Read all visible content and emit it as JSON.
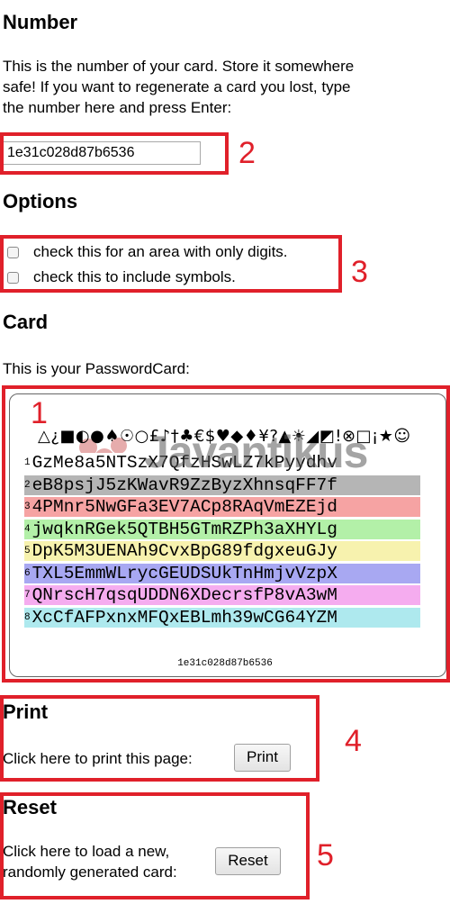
{
  "number_section": {
    "title": "Number",
    "desc_line1": "This is the number of your card. Store it somewhere",
    "desc_line2": "safe! If you want to regenerate a card you lost, type",
    "desc_line3": "the number here and press Enter:",
    "card_number_value": "1e31c028d87b6536"
  },
  "options_section": {
    "title": "Options",
    "digits_label": "check this for an area with only digits.",
    "digits_checked": false,
    "symbols_label": "check this to include symbols.",
    "symbols_checked": false
  },
  "card_section": {
    "title": "Card",
    "desc": "This is your PasswordCard:",
    "header_symbols": "△¿■◐●♠☉○£♪†♣€$♥◆♦¥?▲☀◢◩!⊗□¡★☺",
    "rows": [
      {
        "n": "1",
        "text": "GzMe8a5NTSzX7QfzHSwLZ7kPyydhv",
        "color": "#ffffff"
      },
      {
        "n": "2",
        "text": "eB8psjJ5zKWavR9ZzByzXhnsqFF7f",
        "color": "#b5b5b5"
      },
      {
        "n": "3",
        "text": "4PMnr5NwGFa3EV7ACp8RAqVmEZEjd",
        "color": "#f6a3a3"
      },
      {
        "n": "4",
        "text": "jwqknRGek5QTBH5GTmRZPh3aXHYLg",
        "color": "#b3f0a8"
      },
      {
        "n": "5",
        "text": "DpK5M3UENAh9CvxBpG89fdgxeuGJy",
        "color": "#f7f2ae"
      },
      {
        "n": "6",
        "text": "TXL5EmmWLrycGEUDSUkTnHmjvVzpX",
        "color": "#a8a8f2"
      },
      {
        "n": "7",
        "text": "QNrscH7qsqUDDN6XDecrsfP8vA3wM",
        "color": "#f5acef"
      },
      {
        "n": "8",
        "text": "XcCfAFPxnxMFQxEBLmh39wCG64YZM",
        "color": "#aee9ee"
      }
    ],
    "card_number_footer": "1e31c028d87b6536",
    "watermark": "Javantikus"
  },
  "print_section": {
    "title": "Print",
    "desc": "Click here to print this page:",
    "button_label": "Print"
  },
  "reset_section": {
    "title": "Reset",
    "desc_line1": "Click here to load a new,",
    "desc_line2": "randomly generated card:",
    "button_label": "Reset"
  },
  "annotations": {
    "a1": "1",
    "a2": "2",
    "a3": "3",
    "a4": "4",
    "a5": "5",
    "color": "#e0202a"
  }
}
